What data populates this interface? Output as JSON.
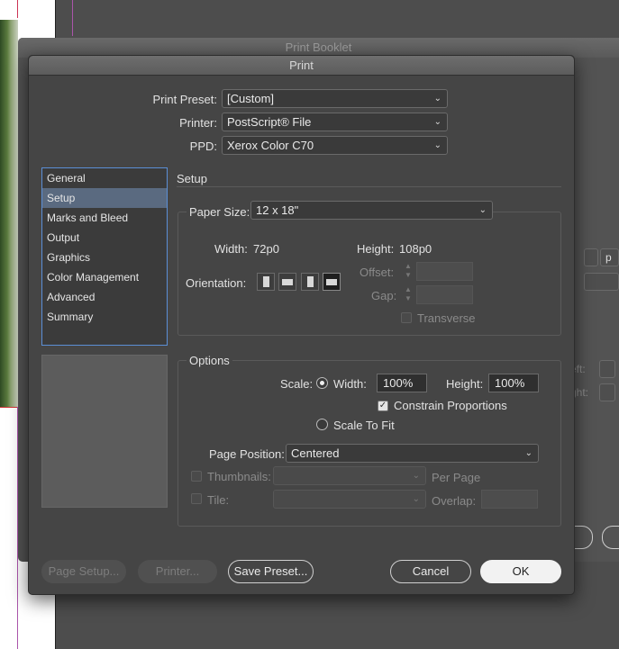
{
  "background_dialog": {
    "title": "Print Booklet",
    "fragments": [
      "p",
      "eft:",
      "ght:"
    ]
  },
  "dialog": {
    "title": "Print",
    "print_preset_label": "Print Preset:",
    "print_preset_value": "[Custom]",
    "printer_label": "Printer:",
    "printer_value": "PostScript® File",
    "ppd_label": "PPD:",
    "ppd_value": "Xerox Color C70"
  },
  "nav": {
    "items": [
      "General",
      "Setup",
      "Marks and Bleed",
      "Output",
      "Graphics",
      "Color Management",
      "Advanced",
      "Summary"
    ],
    "selected": "Setup"
  },
  "setup": {
    "heading": "Setup",
    "paper_size_label": "Paper Size:",
    "paper_size_value": "12 x 18\"",
    "width_label": "Width:",
    "width_value": "72p0",
    "height_label": "Height:",
    "height_value": "108p0",
    "orientation_label": "Orientation:",
    "offset_label": "Offset:",
    "gap_label": "Gap:",
    "transverse_label": "Transverse"
  },
  "options": {
    "heading": "Options",
    "scale_label": "Scale:",
    "width_label": "Width:",
    "width_value": "100%",
    "height_label": "Height:",
    "height_value": "100%",
    "constrain_label": "Constrain Proportions",
    "scale_to_fit_label": "Scale To Fit",
    "page_position_label": "Page Position:",
    "page_position_value": "Centered",
    "thumbnails_label": "Thumbnails:",
    "per_page_label": "Per Page",
    "tile_label": "Tile:",
    "overlap_label": "Overlap:"
  },
  "buttons": {
    "page_setup": "Page Setup...",
    "printer": "Printer...",
    "save_preset": "Save Preset...",
    "cancel": "Cancel",
    "ok": "OK"
  },
  "colors": {
    "accent": "#5b8fd6",
    "dialog_bg": "#454545"
  }
}
